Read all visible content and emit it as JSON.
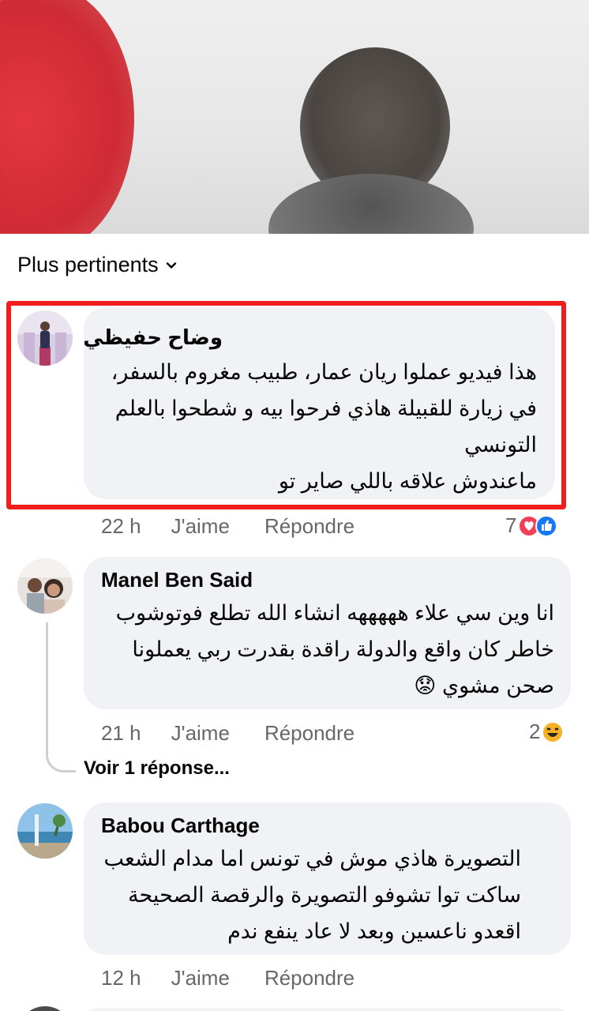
{
  "sort": {
    "label": "Plus pertinents"
  },
  "comments": [
    {
      "author": "وضاح حفيظي",
      "text": "هذا فيديو عملوا ريان عمار، طبيب مغروم بالسفر،\nفي زيارة للقبيلة هاذي فرحوا بيه و شطحوا بالعلم\nالتونسي \nماعندوش علاقه باللي صاير تو",
      "time": "22 h",
      "like": "J'aime",
      "reply": "Répondre",
      "reactions_count": "7"
    },
    {
      "author": "Manel Ben Said",
      "text": "انا وين سي علاء هههههه انشاء الله تطلع فوتوشوب\nخاطر كان واقع والدولة راقدة بقدرت ربي يعملونا\nصحن مشوي 😟",
      "time": "21 h",
      "like": "J'aime",
      "reply": "Répondre",
      "reactions_count": "2",
      "view_replies": "Voir 1 réponse..."
    },
    {
      "author": "Babou Carthage",
      "text": "التصويرة هاذي موش في تونس اما مدام الشعب\nساكت توا تشوفو التصويرة والرقصة الصحيحة\nاقعدو ناعسين وبعد لا عاد ينفع ندم",
      "time": "12 h",
      "like": "J'aime",
      "reply": "Répondre"
    }
  ],
  "colors": {
    "highlight": "#f21d1d",
    "bubble": "#f0f2f5",
    "meta": "#65676b",
    "like_blue": "#1877f2",
    "love_red": "#f33e58",
    "haha_yellow": "#f7b125"
  },
  "icons": [
    "chevron-down-icon",
    "love-reaction-icon",
    "like-reaction-icon",
    "haha-reaction-icon"
  ]
}
